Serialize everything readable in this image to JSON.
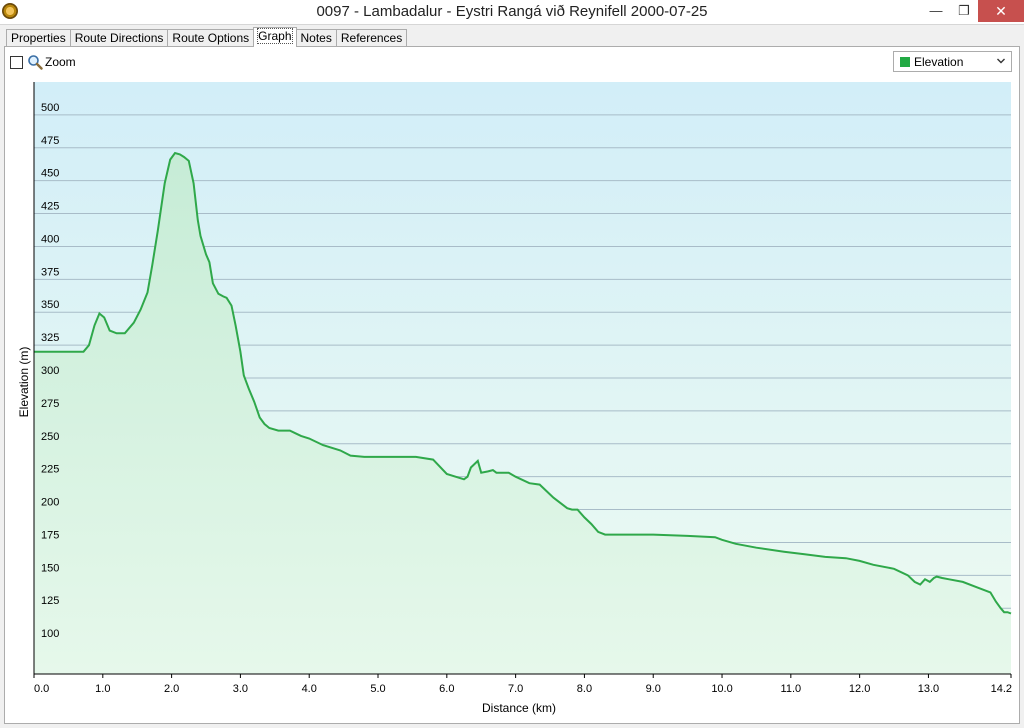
{
  "window": {
    "title": "0097 - Lambadalur - Eystri Rangá við Reynifell 2000-07-25",
    "minimize_glyph": "—",
    "maximize_glyph": "❐",
    "close_glyph": "✕"
  },
  "tabs": [
    {
      "label": "Properties"
    },
    {
      "label": "Route Directions"
    },
    {
      "label": "Route Options"
    },
    {
      "label": "Graph"
    },
    {
      "label": "Notes"
    },
    {
      "label": "References"
    }
  ],
  "active_tab": "Graph",
  "zoom": {
    "label": "Zoom",
    "checked": false,
    "icon": "magnifier-icon"
  },
  "series_select": {
    "selected": "Elevation",
    "swatch_color": "#22aa44"
  },
  "colors": {
    "line": "#2fa84a",
    "fill_top": "#d2eef8",
    "fill_bottom": "#eefbf1",
    "grid": "#a8bcc8"
  },
  "chart_data": {
    "type": "area",
    "xlabel": "Distance  (km)",
    "ylabel": "Elevation (m)",
    "xlim": [
      0,
      14.2
    ],
    "ylim": [
      75,
      525
    ],
    "grid": true,
    "x_ticks": [
      "0.0",
      "1.0",
      "2.0",
      "3.0",
      "4.0",
      "5.0",
      "6.0",
      "7.0",
      "8.0",
      "9.0",
      "10.0",
      "11.0",
      "12.0",
      "13.0",
      "14.2"
    ],
    "x_tick_values": [
      0,
      1,
      2,
      3,
      4,
      5,
      6,
      7,
      8,
      9,
      10,
      11,
      12,
      13,
      14.2
    ],
    "y_ticks": [
      "100",
      "125",
      "150",
      "175",
      "200",
      "225",
      "250",
      "275",
      "300",
      "325",
      "350",
      "375",
      "400",
      "425",
      "450",
      "475",
      "500"
    ],
    "y_tick_values": [
      100,
      125,
      150,
      175,
      200,
      225,
      250,
      275,
      300,
      325,
      350,
      375,
      400,
      425,
      450,
      475,
      500
    ],
    "series": [
      {
        "name": "Elevation",
        "x": [
          0.0,
          0.6,
          0.72,
          0.8,
          0.88,
          0.95,
          1.02,
          1.1,
          1.2,
          1.32,
          1.45,
          1.55,
          1.65,
          1.72,
          1.8,
          1.9,
          1.98,
          2.05,
          2.12,
          2.18,
          2.25,
          2.32,
          2.38,
          2.42,
          2.5,
          2.55,
          2.6,
          2.68,
          2.75,
          2.8,
          2.87,
          2.93,
          3.0,
          3.05,
          3.12,
          3.2,
          3.28,
          3.35,
          3.42,
          3.55,
          3.65,
          3.72,
          3.8,
          3.88,
          4.0,
          4.2,
          4.45,
          4.6,
          4.8,
          5.0,
          5.3,
          5.55,
          5.8,
          6.0,
          6.25,
          6.3,
          6.35,
          6.45,
          6.5,
          6.6,
          6.67,
          6.72,
          6.8,
          6.9,
          7.0,
          7.2,
          7.35,
          7.55,
          7.75,
          7.82,
          7.9,
          8.0,
          8.1,
          8.2,
          8.3,
          8.4,
          8.55,
          8.7,
          9.0,
          9.5,
          9.9,
          10.0,
          10.2,
          10.5,
          10.9,
          11.2,
          11.5,
          11.8,
          12.0,
          12.2,
          12.5,
          12.7,
          12.8,
          12.88,
          12.95,
          13.02,
          13.08,
          13.12,
          13.2,
          13.3,
          13.5,
          13.7,
          13.9,
          13.98,
          14.05,
          14.1,
          14.15,
          14.2
        ],
        "y": [
          320,
          320,
          320,
          325,
          340,
          349,
          346,
          336,
          334,
          334,
          342,
          352,
          365,
          386,
          412,
          448,
          466,
          471,
          470,
          468,
          465,
          448,
          420,
          408,
          394,
          388,
          372,
          364,
          362,
          361,
          355,
          340,
          320,
          302,
          292,
          282,
          270,
          265,
          262,
          260,
          260,
          260,
          258,
          256,
          254,
          249,
          245,
          241,
          240,
          240,
          240,
          240,
          238,
          227,
          223,
          225,
          232,
          237,
          228,
          229,
          230,
          228,
          228,
          228,
          225,
          220,
          219,
          209,
          201,
          200,
          200,
          194,
          189,
          183,
          181,
          181,
          181,
          181,
          181,
          180,
          179,
          177,
          174,
          171,
          168,
          166,
          164,
          163,
          161,
          158,
          155,
          150,
          145,
          143,
          147,
          145,
          148,
          149,
          148,
          147,
          145,
          141,
          137,
          130,
          125,
          122,
          122,
          121
        ]
      }
    ]
  }
}
